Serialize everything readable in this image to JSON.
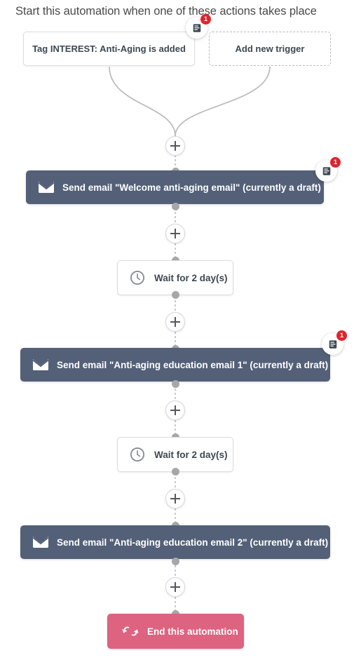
{
  "header": {
    "title": "Start this automation when one of these actions takes place"
  },
  "triggers": [
    {
      "label": "Tag INTEREST: Anti-Aging is added",
      "style": "solid",
      "note_count": "1"
    },
    {
      "label": "Add new trigger",
      "style": "dashed",
      "note_count": null
    }
  ],
  "flow": [
    {
      "type": "email",
      "icon": "envelope-icon",
      "label": "Send email \"Welcome anti-aging email\" (currently a draft)",
      "note_count": "1"
    },
    {
      "type": "wait",
      "icon": "clock-icon",
      "label": "Wait for 2 day(s)",
      "note_count": null
    },
    {
      "type": "email",
      "icon": "envelope-icon",
      "label": "Send email \"Anti-aging education email 1\" (currently a draft)",
      "note_count": "1"
    },
    {
      "type": "wait",
      "icon": "clock-icon",
      "label": "Wait for 2 day(s)",
      "note_count": null
    },
    {
      "type": "email",
      "icon": "envelope-icon",
      "label": "Send email \"Anti-aging education email 2\" (currently a draft)",
      "note_count": null
    }
  ],
  "end_node": {
    "label": "End this automation",
    "icon": "cycle-arrows-icon"
  },
  "add_step": {
    "icon": "plus-icon",
    "count": 6
  },
  "colors": {
    "email_bar": "#536078",
    "end_button": "#dd6380",
    "badge_red": "#e0242d",
    "connector_gray": "#bdbdbd",
    "dot_gray": "#a5a8ab",
    "text_dark": "#3d4852",
    "header_text": "#4a4a4a"
  }
}
